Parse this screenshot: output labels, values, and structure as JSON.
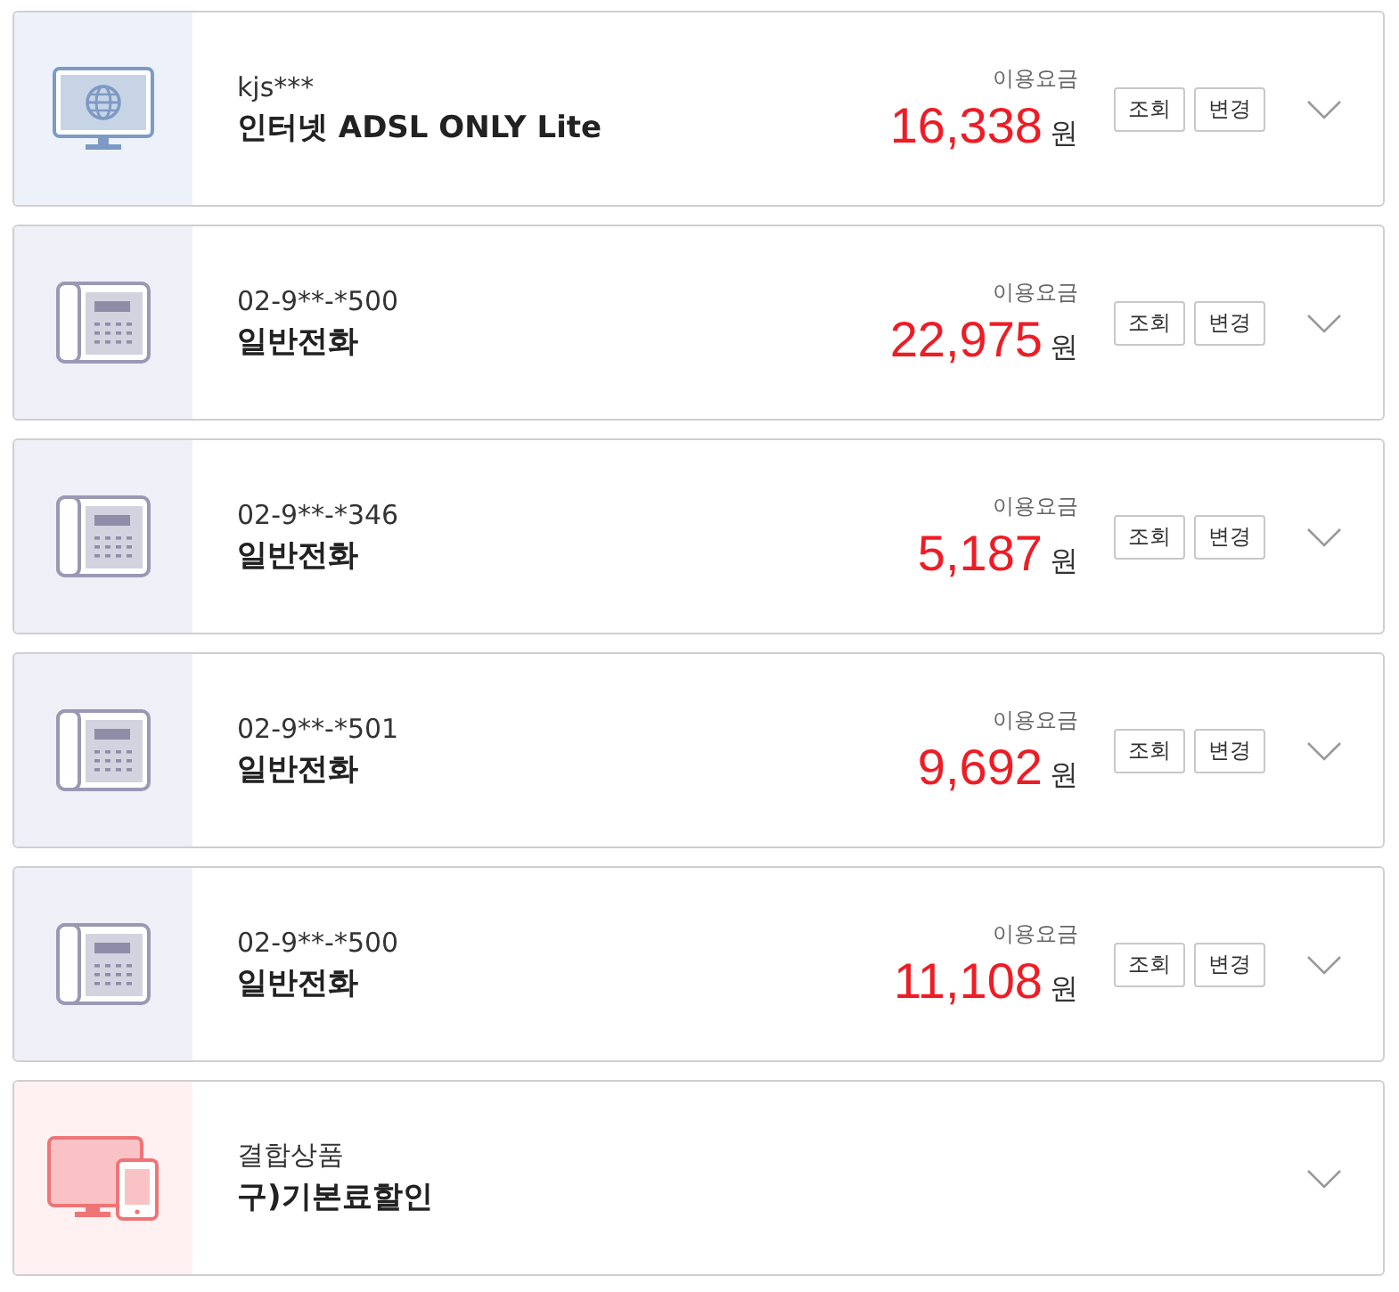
{
  "services": [
    {
      "kind": "internet",
      "account": "kjs***",
      "name": "인터넷 ADSL ONLY Lite",
      "fee_label": "이용요금",
      "amount": "16,338",
      "unit": "원",
      "buttons": [
        "조회",
        "변경"
      ]
    },
    {
      "kind": "phone",
      "account": "02-9**-*500",
      "name": "일반전화",
      "fee_label": "이용요금",
      "amount": "22,975",
      "unit": "원",
      "buttons": [
        "조회",
        "변경"
      ]
    },
    {
      "kind": "phone",
      "account": "02-9**-*346",
      "name": "일반전화",
      "fee_label": "이용요금",
      "amount": "5,187",
      "unit": "원",
      "buttons": [
        "조회",
        "변경"
      ]
    },
    {
      "kind": "phone",
      "account": "02-9**-*501",
      "name": "일반전화",
      "fee_label": "이용요금",
      "amount": "9,692",
      "unit": "원",
      "buttons": [
        "조회",
        "변경"
      ]
    },
    {
      "kind": "phone",
      "account": "02-9**-*500",
      "name": "일반전화",
      "fee_label": "이용요금",
      "amount": "11,108",
      "unit": "원",
      "buttons": [
        "조회",
        "변경"
      ]
    },
    {
      "kind": "bundle",
      "account": "결합상품",
      "name": "구)기본료할인"
    }
  ]
}
